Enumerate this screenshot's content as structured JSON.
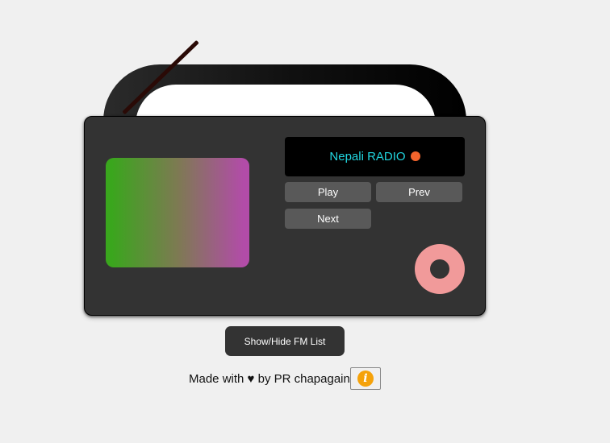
{
  "radio": {
    "display_title": "Nepali RADIO",
    "status_color": "#f2642c",
    "buttons": {
      "play": "Play",
      "prev": "Prev",
      "next": "Next"
    }
  },
  "toggle_fm_list_label": "Show/Hide FM List",
  "footer": {
    "text": "Made with ♥ by PR chapagain",
    "info_icon_glyph": "i"
  },
  "colors": {
    "background": "#f0f0f0",
    "body": "#333333",
    "display_text": "#21d6e0",
    "knob": "#f19a9a",
    "info_icon": "#f5a20a"
  },
  "icons": [
    "antenna",
    "speaker-grille",
    "status-indicator",
    "volume-knob-icon",
    "info-icon"
  ]
}
